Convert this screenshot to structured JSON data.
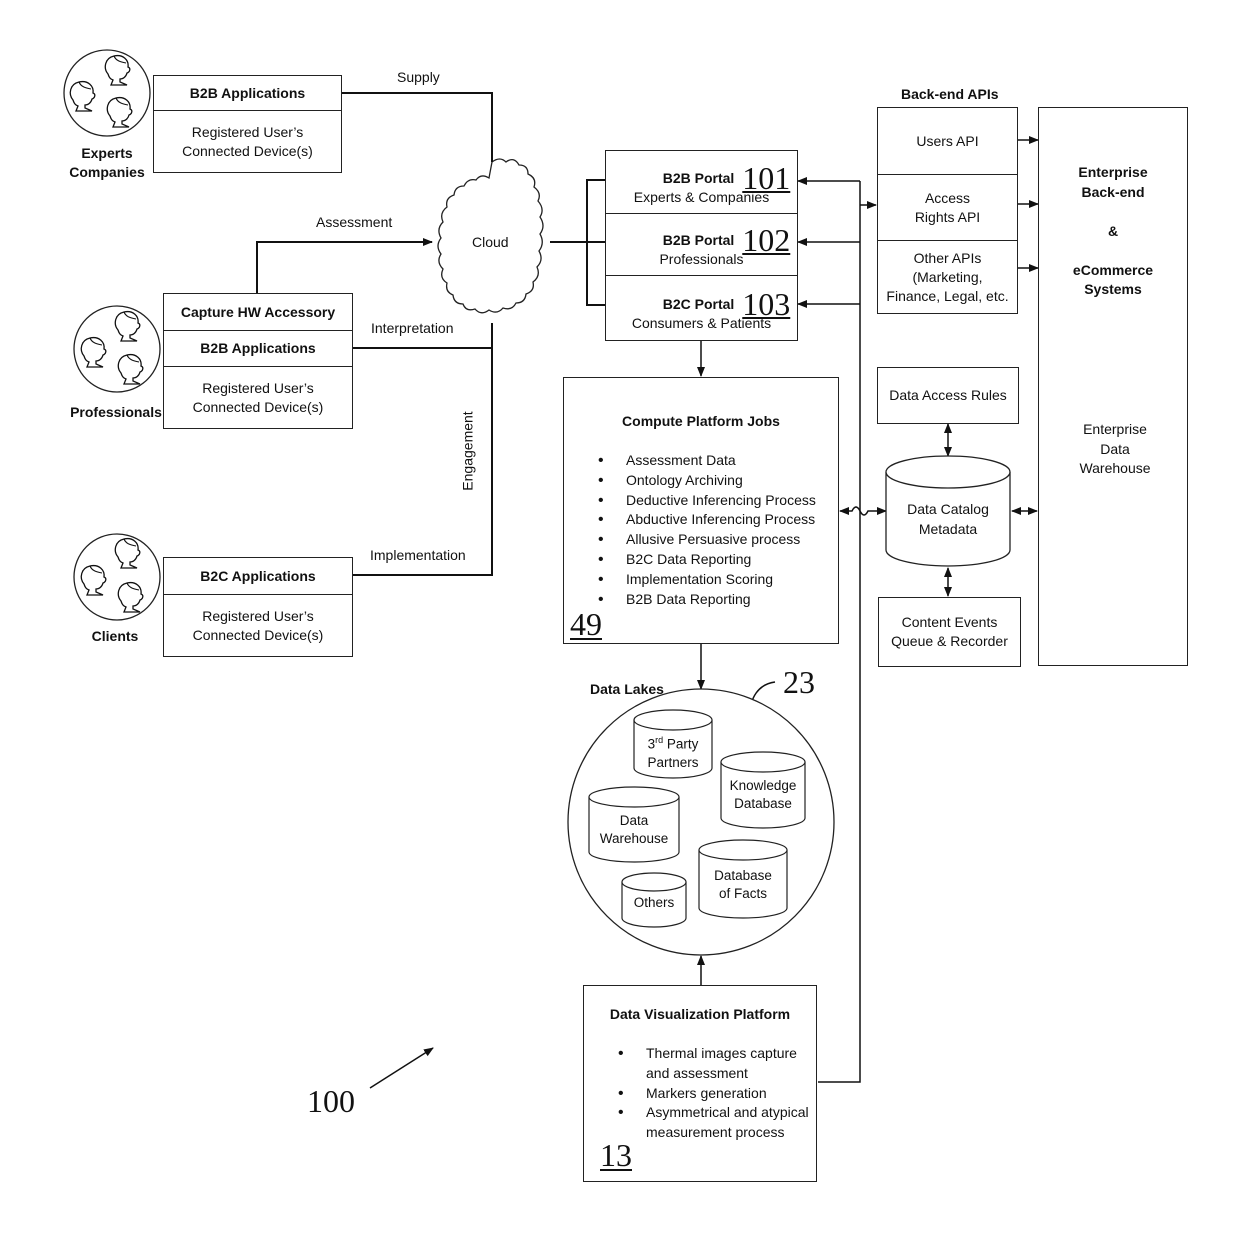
{
  "groups": {
    "experts": {
      "label_line1": "Experts",
      "label_line2": "Companies",
      "app": "B2B Applications",
      "device_line1": "Registered User’s",
      "device_line2": "Connected Device(s)"
    },
    "professionals": {
      "label": "Professionals",
      "accessory": "Capture HW Accessory",
      "app": "B2B Applications",
      "device_line1": "Registered User’s",
      "device_line2": "Connected Device(s)"
    },
    "clients": {
      "label": "Clients",
      "app": "B2C Applications",
      "device_line1": "Registered User’s",
      "device_line2": "Connected Device(s)"
    }
  },
  "flows": {
    "supply": "Supply",
    "assessment": "Assessment",
    "interpretation": "Interpretation",
    "engagement": "Engagement",
    "implementation": "Implementation"
  },
  "cloud": {
    "label": "Cloud"
  },
  "portals": [
    {
      "title": "B2B Portal",
      "subtitle": "Experts & Companies",
      "ref": "101"
    },
    {
      "title": "B2B Portal",
      "subtitle": "Professionals",
      "ref": "102"
    },
    {
      "title": "B2C Portal",
      "subtitle": "Consumers & Patients",
      "ref": "103"
    }
  ],
  "backend_apis": {
    "title": "Back-end APIs",
    "items": [
      {
        "line1": "Users API",
        "line2": "",
        "line3": ""
      },
      {
        "line1": "Access",
        "line2": "Rights API",
        "line3": ""
      },
      {
        "line1": "Other APIs",
        "line2": "(Marketing,",
        "line3": "Finance, Legal, etc."
      }
    ]
  },
  "enterprise": {
    "line1": "Enterprise",
    "line2": "Back-end",
    "line3": "&",
    "line4": "eCommerce",
    "line5": "Systems",
    "warehouse": {
      "line1": "Enterprise",
      "line2": "Data",
      "line3": "Warehouse"
    }
  },
  "compute": {
    "title": "Compute Platform Jobs",
    "ref": "49",
    "items": [
      "Assessment Data",
      "Ontology Archiving",
      "Deductive Inferencing Process",
      "Abductive Inferencing Process",
      "Allusive Persuasive process",
      "B2C Data Reporting",
      "Implementation Scoring",
      "B2B Data Reporting"
    ]
  },
  "data_access_rules": "Data Access Rules",
  "data_catalog": {
    "line1": "Data Catalog",
    "line2": "Metadata"
  },
  "content_events": {
    "line1": "Content Events",
    "line2": "Queue & Recorder"
  },
  "data_lakes": {
    "title": "Data Lakes",
    "ref": "23",
    "stores": {
      "third_party": {
        "line1": "3",
        "sup": "rd",
        "line1b": " Party",
        "line2": "Partners"
      },
      "knowledge": {
        "line1": "Knowledge",
        "line2": "Database"
      },
      "warehouse": {
        "line1": "Data",
        "line2": "Warehouse"
      },
      "facts": {
        "line1": "Database",
        "line2": "of Facts"
      },
      "others": {
        "line1": "Others"
      }
    }
  },
  "visualization": {
    "title": "Data Visualization Platform",
    "ref": "13",
    "items": [
      "Thermal images capture and assessment",
      "Markers generation",
      "Asymmetrical and atypical measurement process"
    ]
  },
  "system_ref": "100"
}
